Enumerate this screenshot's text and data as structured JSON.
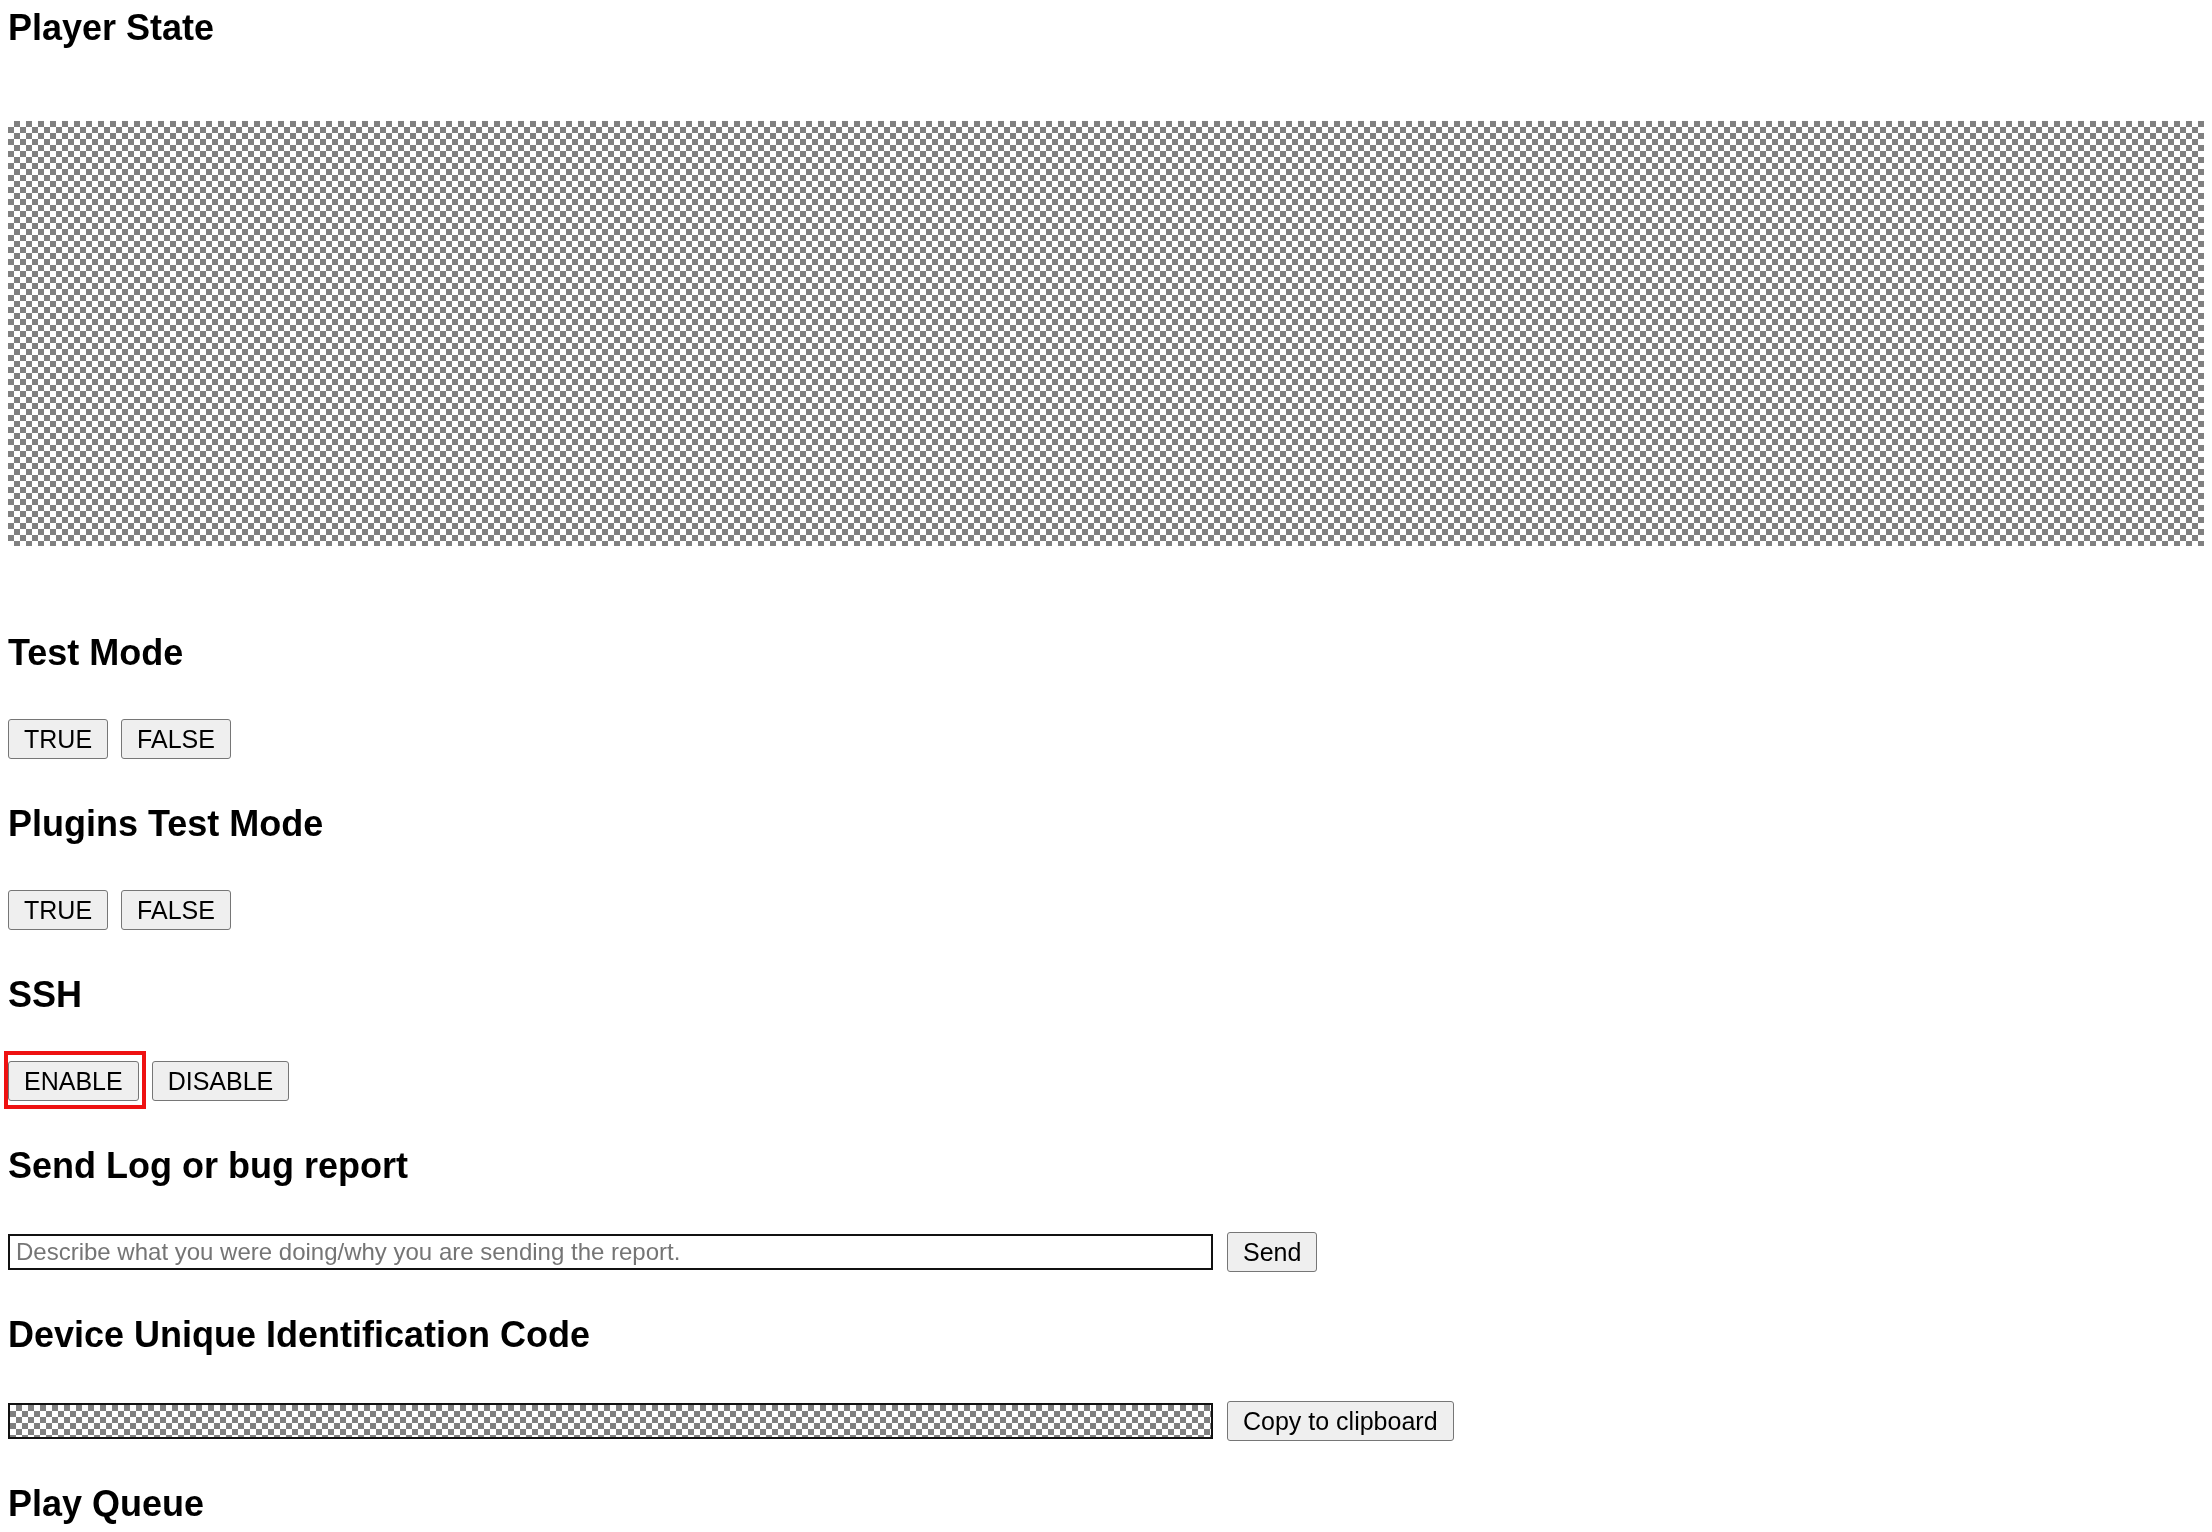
{
  "sections": [
    {
      "title": "Player State",
      "kind": "redacted"
    },
    {
      "title": "Test Mode",
      "kind": "buttons",
      "buttons": [
        {
          "label": "TRUE",
          "highlighted": false
        },
        {
          "label": "FALSE",
          "highlighted": false
        }
      ]
    },
    {
      "title": "Plugins Test Mode",
      "kind": "buttons",
      "buttons": [
        {
          "label": "TRUE",
          "highlighted": false
        },
        {
          "label": "FALSE",
          "highlighted": false
        }
      ]
    },
    {
      "title": "SSH",
      "kind": "buttons",
      "buttons": [
        {
          "label": "ENABLE",
          "highlighted": true
        },
        {
          "label": "DISABLE",
          "highlighted": false
        }
      ]
    },
    {
      "title": "Send Log or bug report",
      "kind": "input",
      "placeholder": "Describe what you were doing/why you are sending the report.",
      "button": "Send"
    },
    {
      "title": "Device Unique Identification Code",
      "kind": "code",
      "button": "Copy to clipboard"
    },
    {
      "title": "Play Queue",
      "kind": "heading"
    }
  ]
}
